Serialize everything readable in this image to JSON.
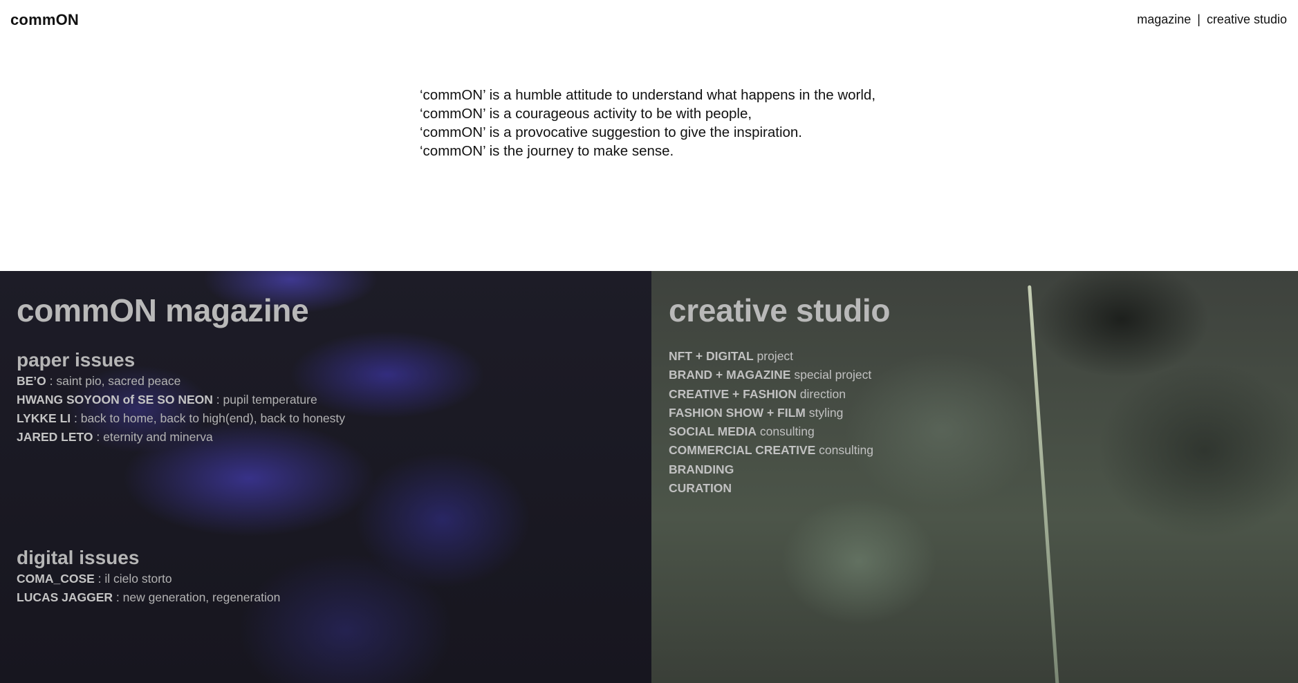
{
  "header": {
    "logo": "commON",
    "nav": {
      "magazine": "magazine",
      "separator": "|",
      "studio": "creative studio"
    }
  },
  "manifesto": [
    "‘commON’ is a humble attitude to understand what happens in the world,",
    "‘commON’ is a courageous activity to be with people,",
    "‘commON’ is a provocative suggestion to give the inspiration.",
    "‘commON’ is the journey to make sense."
  ],
  "magazine": {
    "title": "commON magazine",
    "paper": {
      "heading": "paper issues",
      "items": [
        {
          "artist": "BE’O",
          "sep": " : ",
          "title": "saint pio, sacred peace"
        },
        {
          "artist": "HWANG SOYOON of SE SO NEON",
          "sep": " : ",
          "title": "pupil temperature"
        },
        {
          "artist": "LYKKE LI",
          "sep": " : ",
          "title": "back to home, back to high(end), back to honesty"
        },
        {
          "artist": "JARED LETO",
          "sep": " : ",
          "title": "eternity and minerva"
        }
      ]
    },
    "digital": {
      "heading": "digital issues",
      "items": [
        {
          "artist": "COMA_COSE",
          "sep": " : ",
          "title": "il cielo storto"
        },
        {
          "artist": "LUCAS JAGGER",
          "sep": " : ",
          "title": "new generation, regeneration"
        }
      ]
    }
  },
  "studio": {
    "title": "creative studio",
    "services": [
      {
        "bold": "NFT + DIGITAL",
        "lite": " project"
      },
      {
        "bold": "BRAND + MAGAZINE",
        "lite": " special project"
      },
      {
        "bold": "CREATIVE + FASHION",
        "lite": " direction"
      },
      {
        "bold": "FASHION SHOW + FILM",
        "lite": " styling"
      },
      {
        "bold": "SOCIAL MEDIA",
        "lite": " consulting"
      },
      {
        "bold": "COMMERCIAL CREATIVE",
        "lite": " consulting"
      },
      {
        "bold": "BRANDING",
        "lite": ""
      },
      {
        "bold": "CURATION",
        "lite": ""
      }
    ]
  }
}
